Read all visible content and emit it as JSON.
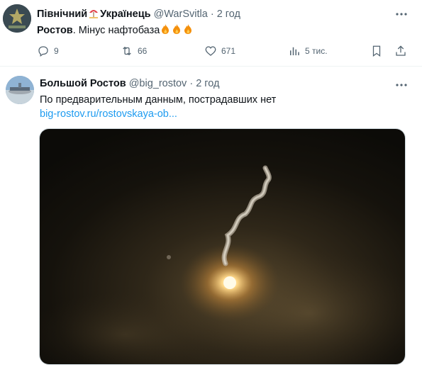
{
  "tweet1": {
    "display_name_part1": "Північний",
    "display_name_part2": "Українець",
    "handle": "@WarSvitla",
    "separator": "·",
    "time": "2 год",
    "text_bold": "Ростов",
    "text_rest": ". Мінус нафтобаза",
    "actions": {
      "replies": "9",
      "reposts": "66",
      "likes": "671",
      "views": "5 тис."
    }
  },
  "tweet2": {
    "display_name": "Большой Ростов",
    "handle": "@big_rostov",
    "separator": "·",
    "time": "2 год",
    "text": "По предварительным данным, пострадавших нет",
    "link": "big-rostov.ru/rostovskaya-ob..."
  },
  "icons": {
    "flag": "umbrella-beach-emoji-icon",
    "fire": "fire-emoji-icon",
    "reply": "reply-icon",
    "repost": "repost-icon",
    "like": "heart-icon",
    "views": "views-icon",
    "bookmark": "bookmark-icon",
    "share": "share-icon",
    "more": "more-icon"
  },
  "colors": {
    "link": "#1d9bf0",
    "secondary_text": "#536471",
    "fire": "#f4900c"
  }
}
